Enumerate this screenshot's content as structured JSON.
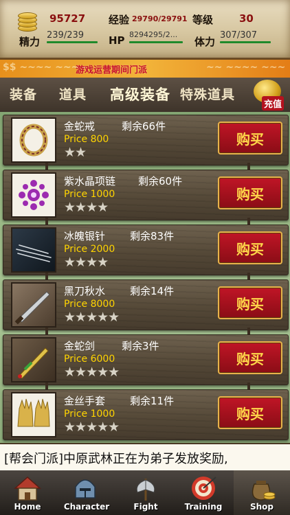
{
  "stats": {
    "gold": "95727",
    "exp_label": "经验",
    "exp_value": "29790/29791",
    "level_label": "等级",
    "level_value": "30",
    "energy_label": "精力",
    "energy_value": "239/239",
    "hp_label": "HP",
    "hp_value": "8294295/2...",
    "stamina_label": "体力",
    "stamina_value": "307/307"
  },
  "promo": {
    "text": "游戏运营期间门派"
  },
  "tabs": [
    {
      "label": "装备",
      "active": false
    },
    {
      "label": "道具",
      "active": false
    },
    {
      "label": "高级装备",
      "active": true
    },
    {
      "label": "特殊道具",
      "active": false
    }
  ],
  "recharge_label": "充值",
  "items": [
    {
      "name": "金蛇戒",
      "stock": "剩余66件",
      "price": "Price 800",
      "stars": "★★",
      "stars_count": 2,
      "buy": "购买",
      "icon": "ring-icon"
    },
    {
      "name": "紫水晶项链",
      "stock": "剩余60件",
      "price": "Price 1000",
      "stars": "★★★★",
      "stars_count": 4,
      "buy": "购买",
      "icon": "necklace-icon"
    },
    {
      "name": "冰魄银针",
      "stock": "剩余83件",
      "price": "Price 2000",
      "stars": "★★★★",
      "stars_count": 4,
      "buy": "购买",
      "icon": "needles-icon"
    },
    {
      "name": "黑刀秋水",
      "stock": "剩余14件",
      "price": "Price 8000",
      "stars": "★★★★★",
      "stars_count": 5,
      "buy": "购买",
      "icon": "blade-icon"
    },
    {
      "name": "金蛇剑",
      "stock": "剩余3件",
      "price": "Price 6000",
      "stars": "★★★★★",
      "stars_count": 5,
      "buy": "购买",
      "icon": "sword-icon"
    },
    {
      "name": "金丝手套",
      "stock": "剩余11件",
      "price": "Price 1000",
      "stars": "★★★★★",
      "stars_count": 5,
      "buy": "购买",
      "icon": "gloves-icon"
    }
  ],
  "ticker": "[帮会门派]中原武林正在为弟子发放奖励,",
  "nav": [
    {
      "label": "Home",
      "icon": "house-icon",
      "active": false
    },
    {
      "label": "Character",
      "icon": "helmet-icon",
      "active": false
    },
    {
      "label": "Fight",
      "icon": "axe-icon",
      "active": false
    },
    {
      "label": "Training",
      "icon": "target-icon",
      "active": false
    },
    {
      "label": "Shop",
      "icon": "coin-bag-icon",
      "active": true
    }
  ]
}
